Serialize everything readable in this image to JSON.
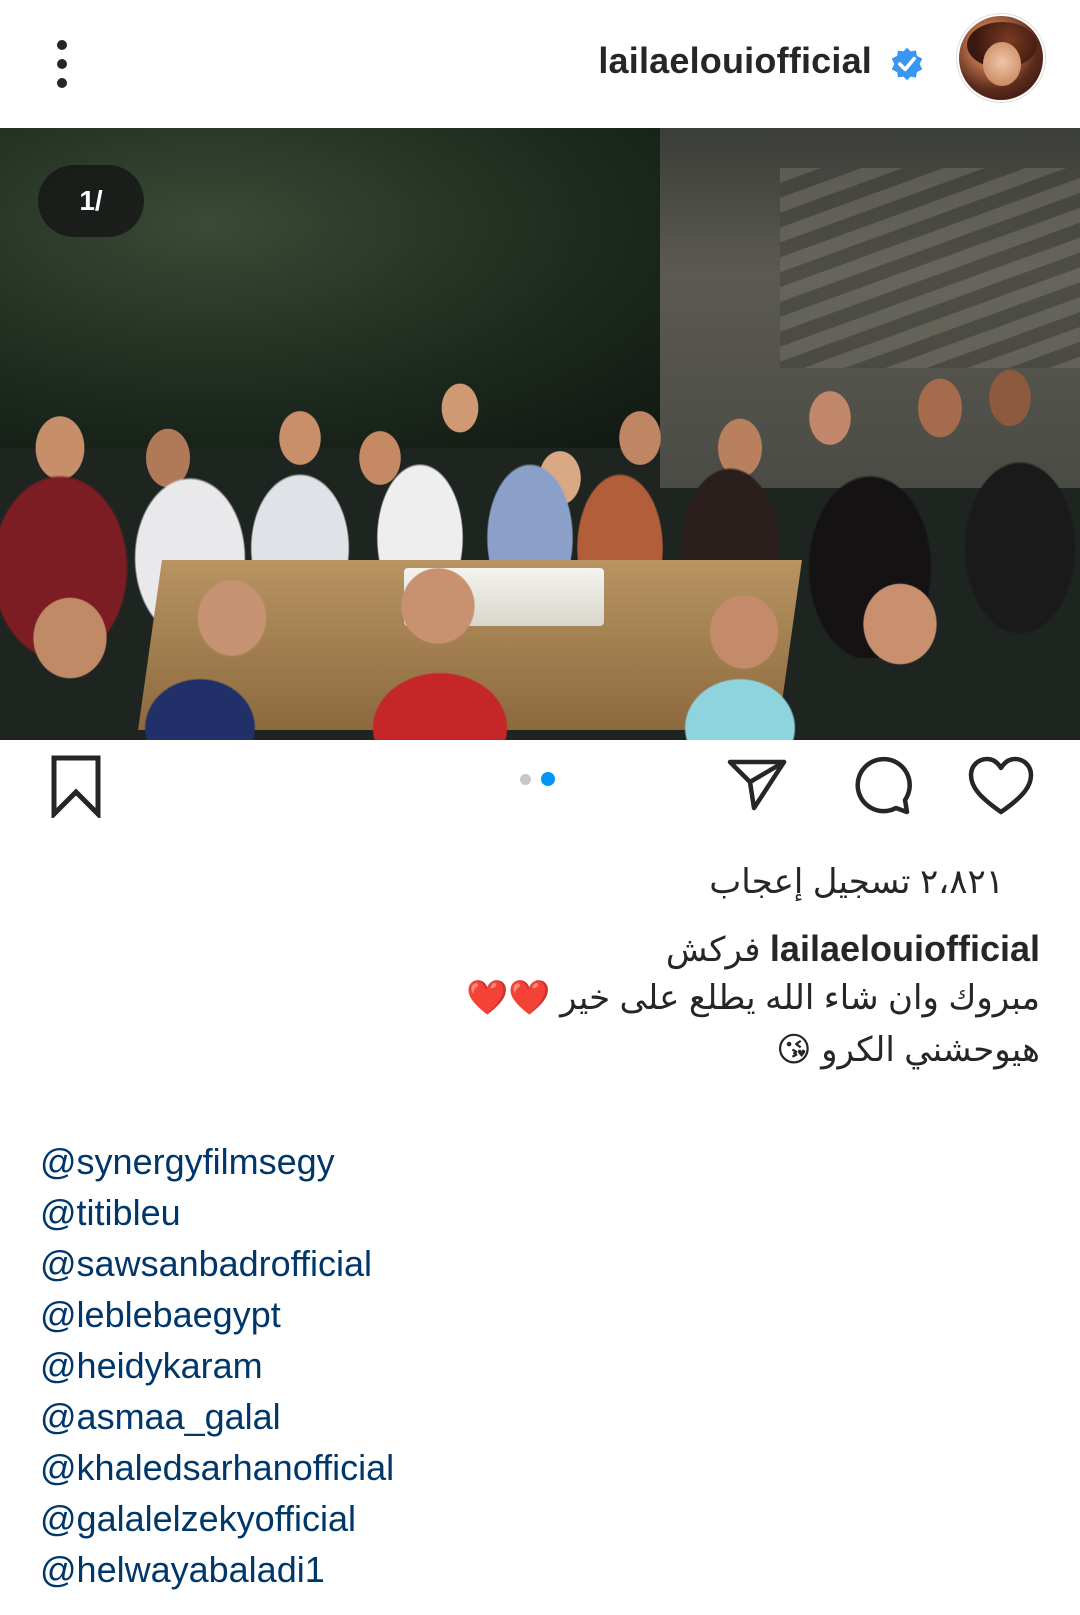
{
  "header": {
    "username": "lailaelouiofficial",
    "verified": true,
    "accent_color": "#3897f0"
  },
  "post": {
    "media_counter": "1/",
    "carousel_dots": 2,
    "active_dot": 2
  },
  "actions": {
    "icons": [
      "bookmark-icon",
      "share-icon",
      "comment-icon",
      "heart-icon"
    ],
    "active_dot_color": "#0095f6"
  },
  "caption": {
    "likes": "٢،٨٢١ تسجيل إعجاب",
    "username": "lailaelouiofficial",
    "line1_text": "فركش",
    "line2_text": "مبروك وان شاء الله يطلع على خير",
    "line2_emoji": "❤️❤️",
    "line3_text": "هيوحشني الكرو",
    "line3_emoji": "😘",
    "mentions": [
      "@synergyfilmsegy",
      "@titibleu",
      "@sawsanbadrofficial",
      "@leblebaegypt",
      "@heidykaram",
      "@asmaa_galal",
      "@khaledsarhanofficial",
      "@galalelzekyofficial",
      "@helwayabaladi1"
    ],
    "mention_color": "#00376b"
  }
}
